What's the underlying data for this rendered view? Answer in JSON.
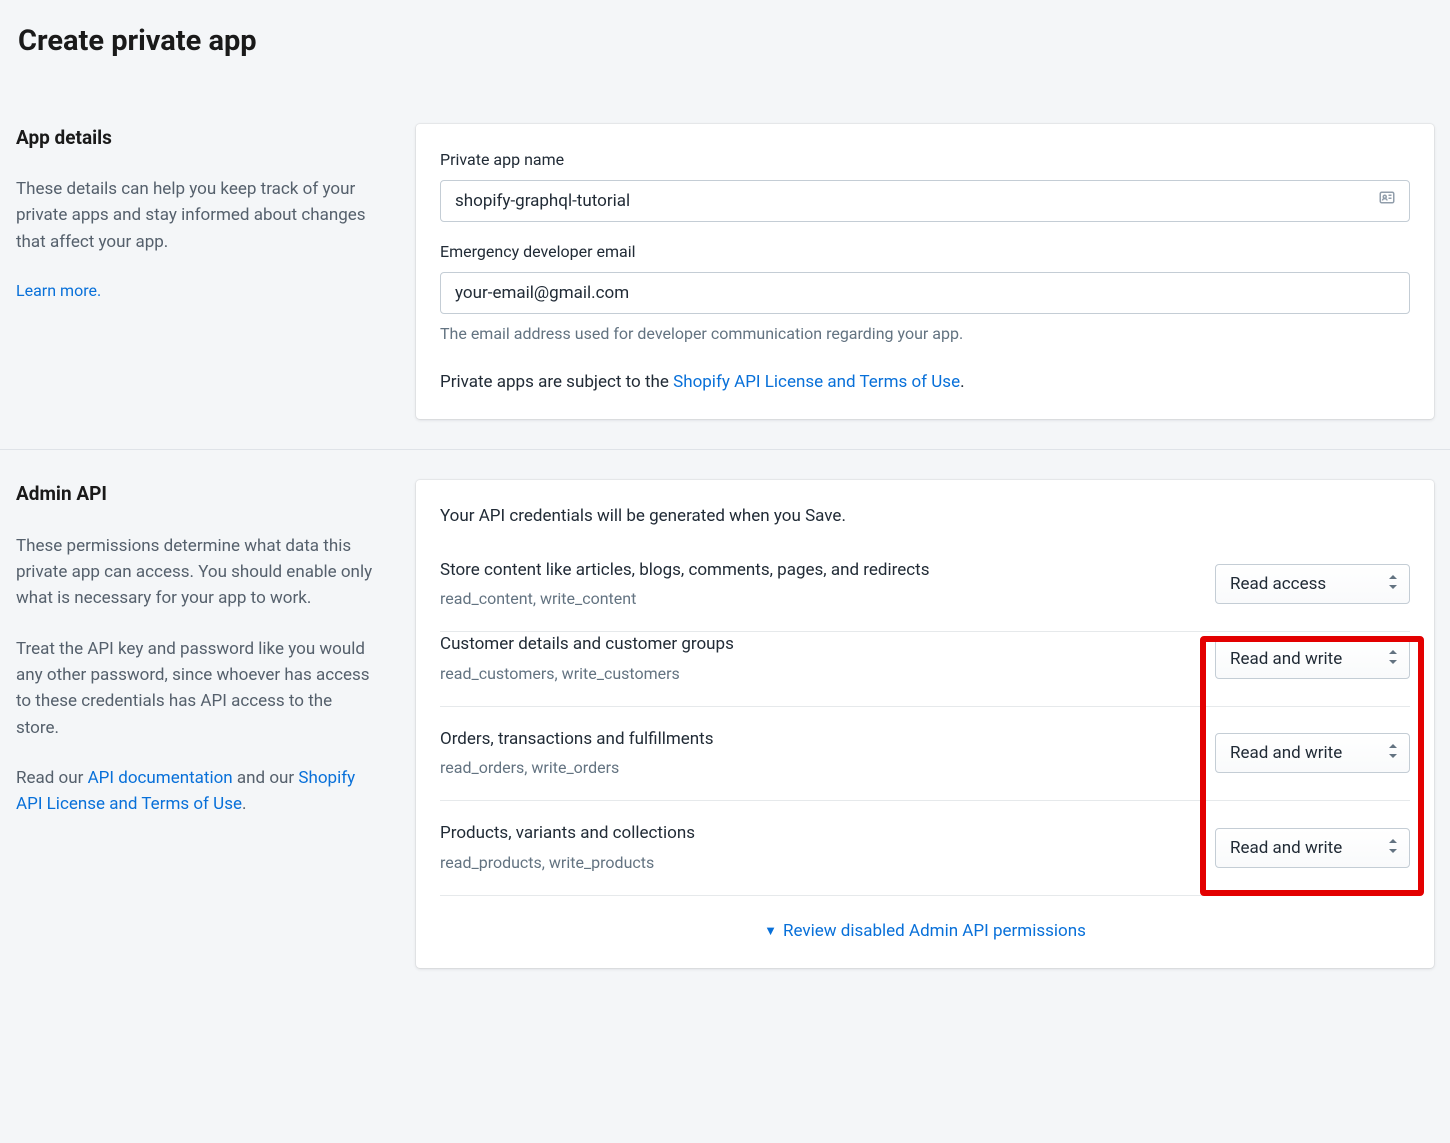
{
  "page_title": "Create private app",
  "app_details": {
    "heading": "App details",
    "description": "These details can help you keep track of your private apps and stay informed about changes that affect your app.",
    "learn_more": "Learn more",
    "name_label": "Private app name",
    "name_value": "shopify-graphql-tutorial",
    "email_label": "Emergency developer email",
    "email_value": "your-email@gmail.com",
    "email_help": "The email address used for developer communication regarding your app.",
    "terms_prefix": "Private apps are subject to the ",
    "terms_link": "Shopify API License and Terms of Use",
    "terms_suffix": "."
  },
  "admin_api": {
    "heading": "Admin API",
    "desc1": "These permissions determine what data this private app can access. You should enable only what is necessary for your app to work.",
    "desc2": "Treat the API key and password like you would any other password, since whoever has access to these credentials has API access to the store.",
    "doc_prefix": "Read our ",
    "doc_link": "API documentation",
    "doc_mid": " and our ",
    "license_link": "Shopify API License and Terms of Use",
    "doc_suffix": ".",
    "credentials_note": "Your API credentials will be generated when you Save.",
    "permissions": [
      {
        "title": "Store content like articles, blogs, comments, pages, and redirects",
        "scopes": "read_content, write_content",
        "value": "Read access"
      },
      {
        "title": "Customer details and customer groups",
        "scopes": "read_customers, write_customers",
        "value": "Read and write"
      },
      {
        "title": "Orders, transactions and fulfillments",
        "scopes": "read_orders, write_orders",
        "value": "Read and write"
      },
      {
        "title": "Products, variants and collections",
        "scopes": "read_products, write_products",
        "value": "Read and write"
      }
    ],
    "review_link": "Review disabled Admin API permissions"
  }
}
